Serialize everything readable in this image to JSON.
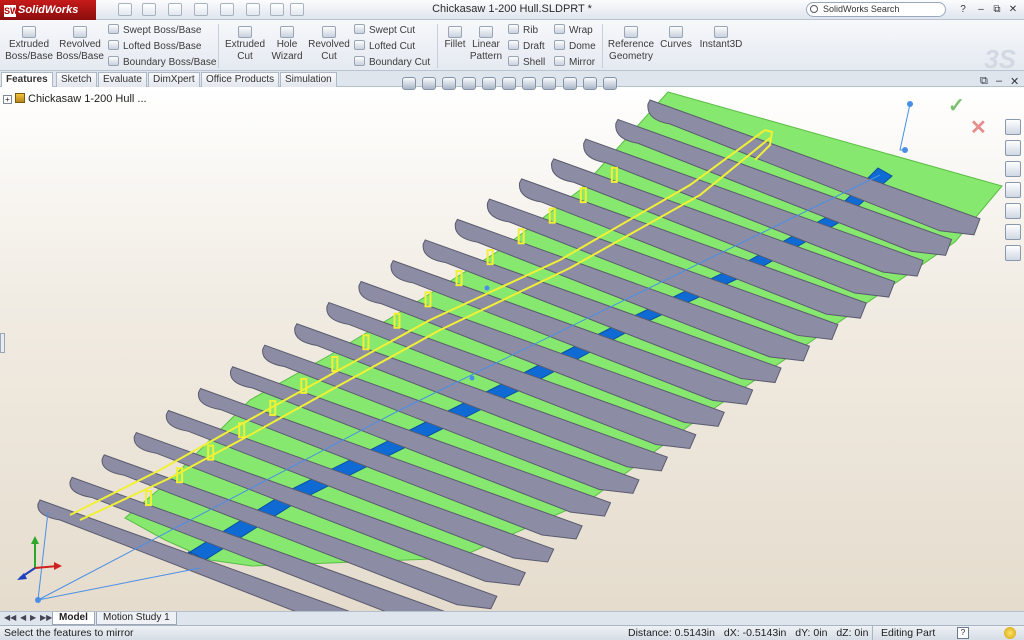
{
  "app": {
    "name": "SolidWorks"
  },
  "titlebar": {
    "document_title": "Chickasaw 1-200 Hull.SLDPRT *",
    "search_placeholder": "SolidWorks Search",
    "help_label": "?",
    "minimize_label": "–",
    "restore_label": "⧉",
    "close_label": "✕"
  },
  "features_toolbar": {
    "extruded_boss": "Extruded Boss/Base",
    "revolved_boss": "Revolved Boss/Base",
    "swept_boss": "Swept Boss/Base",
    "lofted_boss": "Lofted Boss/Base",
    "boundary_boss": "Boundary Boss/Base",
    "extruded_cut": "Extruded Cut",
    "hole_wizard": "Hole Wizard",
    "revolved_cut": "Revolved Cut",
    "swept_cut": "Swept Cut",
    "lofted_cut": "Lofted Cut",
    "boundary_cut": "Boundary Cut",
    "fillet": "Fillet",
    "linear_pattern": "Linear Pattern",
    "rib": "Rib",
    "draft": "Draft",
    "shell": "Shell",
    "wrap": "Wrap",
    "dome": "Dome",
    "mirror": "Mirror",
    "reference_geometry": "Reference Geometry",
    "curves": "Curves",
    "instant3d": "Instant3D"
  },
  "tabs": [
    "Features",
    "Sketch",
    "Evaluate",
    "DimXpert",
    "Office Products",
    "Simulation"
  ],
  "active_tab": "Features",
  "feature_tree": {
    "root_label": "Chickasaw 1-200 Hull ..."
  },
  "viewport": {
    "colors": {
      "deck": "#86e86f",
      "frames": "#8c8da4",
      "keel": "#0f6bd3",
      "selection": "#f1f035",
      "sketch_line": "#4a8fe6"
    }
  },
  "bottom_tabs": [
    "Model",
    "Motion Study 1"
  ],
  "active_bottom_tab": "Model",
  "status": {
    "message": "Select the features to mirror",
    "distance": "Distance: 0.5143in",
    "dx": "dX: -0.5143in",
    "dy": "dY: 0in",
    "dz": "dZ: 0in",
    "mode": "Editing Part"
  }
}
